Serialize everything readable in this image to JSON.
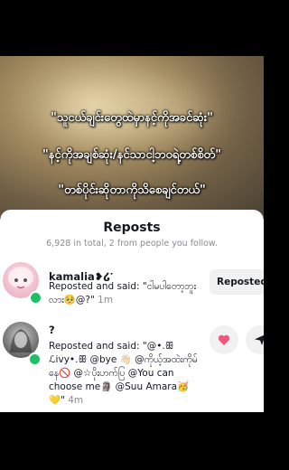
{
  "captions": {
    "line1": "\"သူငယ်ချင်းတွေထဲမှာနင့်ကိုအခင်ဆုံး\"",
    "line2": "\"နင့်ကိုအချစ်ဆုံး/နင်သာငါ့ဘဝရဲ့တစ်စိတ်\"",
    "line3": "\"တစ်ပိုင်းဆိုတာကိုသိစေချင်တယ်\""
  },
  "reposts": {
    "title": "Reposts",
    "summary": "6,928 in total, 2 from people you follow.",
    "items": [
      {
        "username": "kamalia❥໒་",
        "said_text": "Reposted and said: \"ငါမပါတော့ဘူးလား🥺@?\"",
        "time": "1m",
        "button": "Reposted"
      },
      {
        "username": "?",
        "said_text": "Reposted and said: \"@•.ꕥ ℒivy•.ꕥ @bye 👋🏻 @ကိုယ့်အထဲးကိုမ်နေ🚫 @☆ပိုးဟက်ပြ @You can choose me🗿 @Suu Amara🥳💛\"",
        "time": "4m"
      }
    ]
  },
  "icons": {
    "heart": "heart-icon",
    "share": "share-icon"
  },
  "colors": {
    "online": "#1fbf67",
    "heart": "#f2567a"
  }
}
